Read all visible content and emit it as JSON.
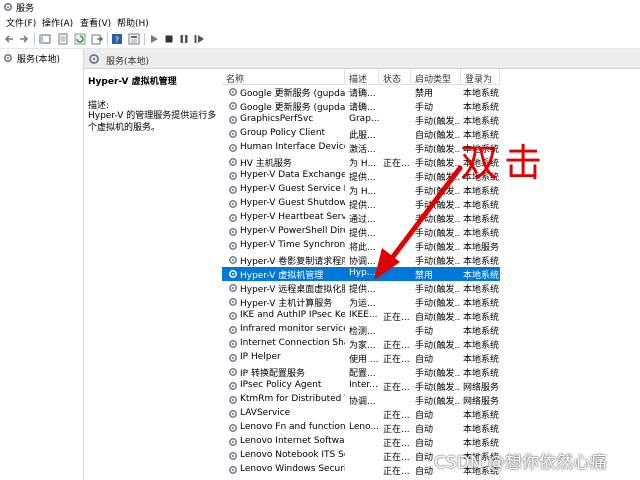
{
  "window": {
    "title": "服务"
  },
  "menu": [
    "文件(F)",
    "操作(A)",
    "查看(V)",
    "帮助(H)"
  ],
  "tree": {
    "root_label": "服务(本地)"
  },
  "pane_header": {
    "label": "服务(本地)"
  },
  "details": {
    "title": "Hyper-V 虚拟机管理",
    "desc_label": "描述:",
    "desc_text": "Hyper-V 的管理服务提供运行多个虚拟机的服务。"
  },
  "columns": [
    "名称",
    "描述",
    "状态",
    "启动类型",
    "登录为"
  ],
  "rows": [
    {
      "name": "Google 更新服务 (gupdate)",
      "desc": "请确...",
      "state": "",
      "start": "禁用",
      "logon": "本地系统"
    },
    {
      "name": "Google 更新服务 (gupdate...",
      "desc": "请确...",
      "state": "",
      "start": "手动",
      "logon": "本地系统"
    },
    {
      "name": "GraphicsPerfSvc",
      "desc": "Grap...",
      "state": "",
      "start": "手动(触发...",
      "logon": "本地系统"
    },
    {
      "name": "Group Policy Client",
      "desc": "此服...",
      "state": "",
      "start": "自动(触发...",
      "logon": "本地系统"
    },
    {
      "name": "Human Interface Device S...",
      "desc": "激活...",
      "state": "",
      "start": "手动(触发...",
      "logon": "本地系统"
    },
    {
      "name": "HV 主机服务",
      "desc": "为 H...",
      "state": "正在...",
      "start": "手动(触发...",
      "logon": "本地系统"
    },
    {
      "name": "Hyper-V Data Exchange Se...",
      "desc": "提供...",
      "state": "",
      "start": "手动(触发...",
      "logon": "本地系统"
    },
    {
      "name": "Hyper-V Guest Service Int...",
      "desc": "为 H...",
      "state": "",
      "start": "手动(触发...",
      "logon": "本地系统"
    },
    {
      "name": "Hyper-V Guest Shutdown ...",
      "desc": "提供...",
      "state": "",
      "start": "手动(触发...",
      "logon": "本地系统"
    },
    {
      "name": "Hyper-V Heartbeat Service",
      "desc": "通过...",
      "state": "",
      "start": "手动(触发...",
      "logon": "本地系统"
    },
    {
      "name": "Hyper-V PowerShell Direct...",
      "desc": "提供...",
      "state": "",
      "start": "手动(触发...",
      "logon": "本地系统"
    },
    {
      "name": "Hyper-V Time Synchroniza...",
      "desc": "将此...",
      "state": "",
      "start": "手动(触发...",
      "logon": "本地服务"
    },
    {
      "name": "Hyper-V 卷影复制请求程序",
      "desc": "协调...",
      "state": "",
      "start": "手动(触发...",
      "logon": "本地系统"
    },
    {
      "name": "Hyper-V 虚拟机管理",
      "desc": "Hyp...",
      "state": "",
      "start": "禁用",
      "logon": "本地系统"
    },
    {
      "name": "Hyper-V 远程桌面虚拟化服...",
      "desc": "提供...",
      "state": "",
      "start": "手动(触发...",
      "logon": "本地系统"
    },
    {
      "name": "Hyper-V 主机计算服务",
      "desc": "为运...",
      "state": "",
      "start": "手动(触发...",
      "logon": "本地系统"
    },
    {
      "name": "IKE and AuthIP IPsec Keyin...",
      "desc": "IKEE...",
      "state": "正在...",
      "start": "自动(触发...",
      "logon": "本地系统"
    },
    {
      "name": "Infrared monitor service",
      "desc": "检测...",
      "state": "",
      "start": "手动",
      "logon": "本地系统"
    },
    {
      "name": "Internet Connection Sharin...",
      "desc": "为家...",
      "state": "正在...",
      "start": "手动(触发...",
      "logon": "本地系统"
    },
    {
      "name": "IP Helper",
      "desc": "使用 ...",
      "state": "正在...",
      "start": "自动",
      "logon": "本地系统"
    },
    {
      "name": "IP 转换配置服务",
      "desc": "配置...",
      "state": "",
      "start": "手动(触发...",
      "logon": "本地系统"
    },
    {
      "name": "IPsec Policy Agent",
      "desc": "Inter...",
      "state": "正在...",
      "start": "手动(触发...",
      "logon": "网络服务"
    },
    {
      "name": "KtmRm for Distributed Tra...",
      "desc": "协调...",
      "state": "",
      "start": "手动(触发...",
      "logon": "网络服务"
    },
    {
      "name": "LAVService",
      "desc": "",
      "state": "正在...",
      "start": "自动",
      "logon": "本地系统"
    },
    {
      "name": "Lenovo Fn and function ke...",
      "desc": "Leno...",
      "state": "正在...",
      "start": "自动",
      "logon": "本地系统"
    },
    {
      "name": "Lenovo Internet Software F...",
      "desc": "",
      "state": "正在...",
      "start": "自动",
      "logon": "本地系统"
    },
    {
      "name": "Lenovo Notebook ITS Serv...",
      "desc": "",
      "state": "正在...",
      "start": "自动",
      "logon": "本地系统"
    },
    {
      "name": "Lenovo Windows Security ...",
      "desc": "",
      "state": "正在...",
      "start": "自动",
      "logon": "本地系统"
    }
  ],
  "selected_row": 13,
  "annotation": {
    "text": "双击",
    "color": "#e00000"
  },
  "watermark": "CSDN @想你依然心痛",
  "colors": {
    "selection": "#0078d7",
    "header_bg": "#ececec"
  }
}
